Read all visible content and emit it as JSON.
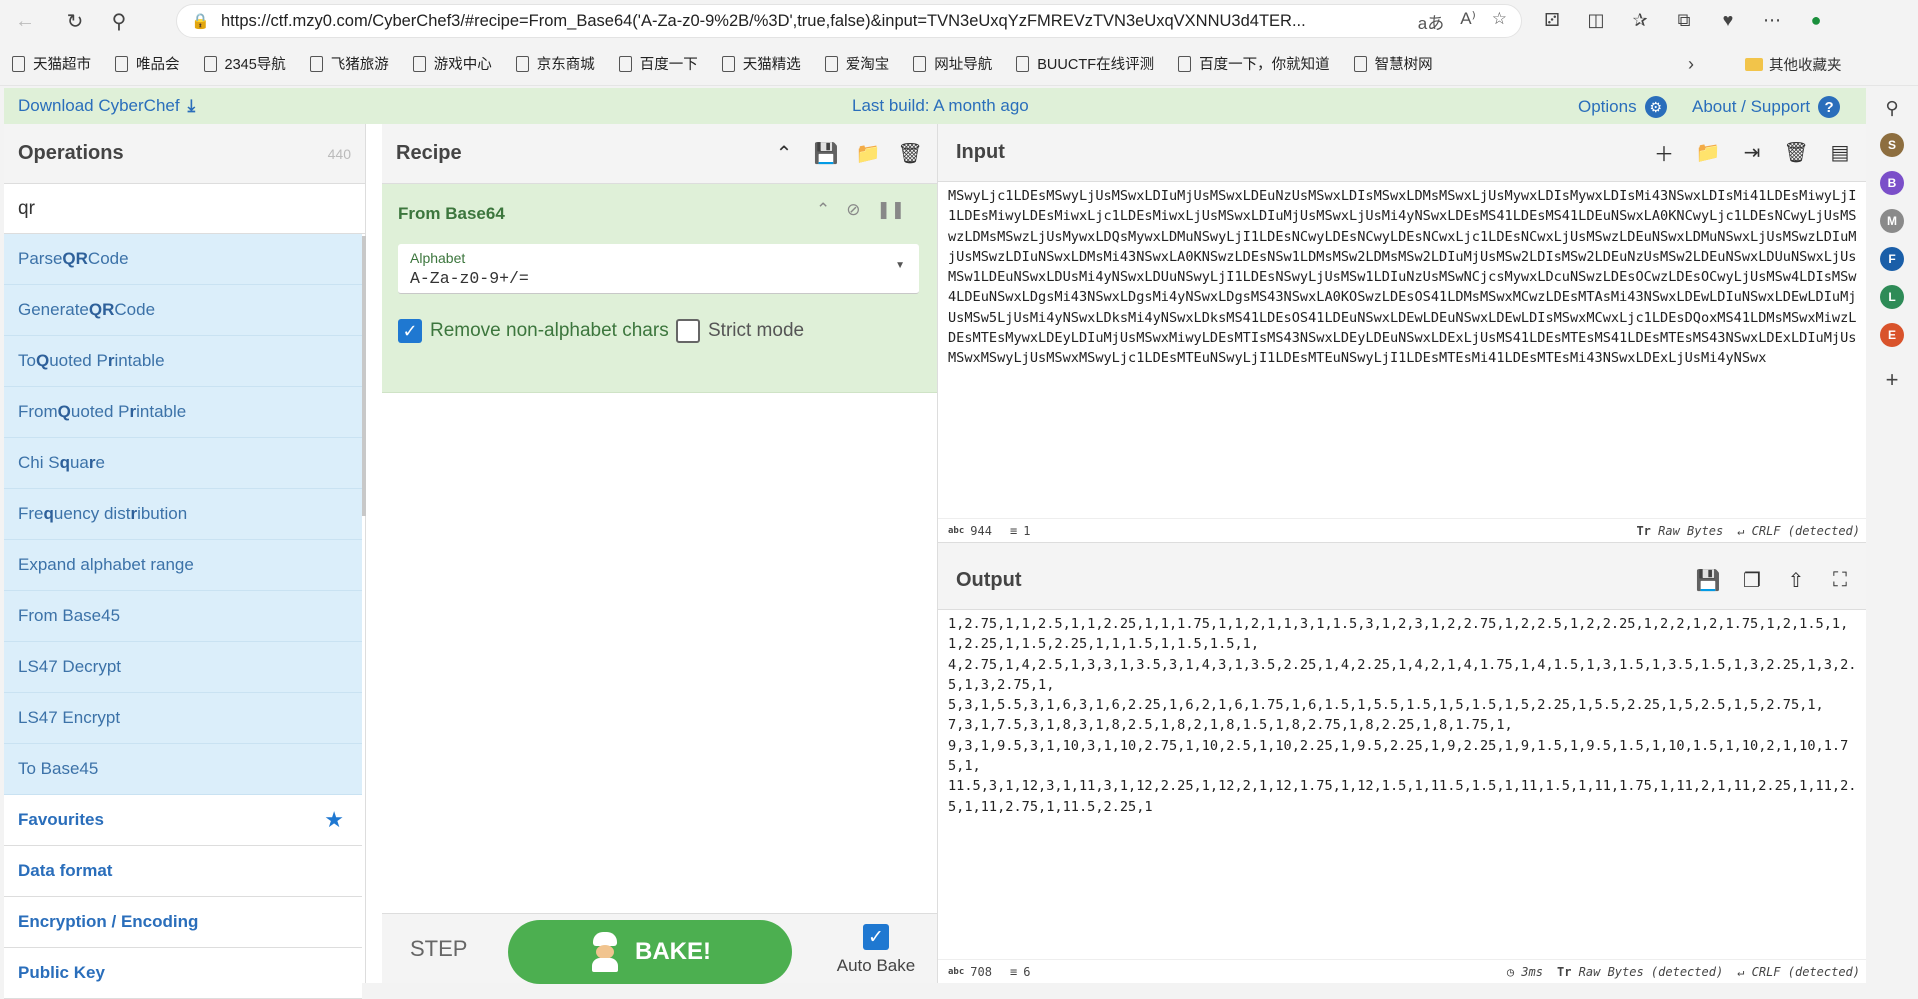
{
  "browser": {
    "url": "https://ctf.mzy0.com/CyberChef3/#recipe=From_Base64('A-Za-z0-9%2B/%3D',true,false)&input=TVN3eUxqYzFMREVzTVN3eUxqVXNNU3d4TER...",
    "bookmarks": [
      "天猫超市",
      "唯品会",
      "2345导航",
      "飞猪旅游",
      "游戏中心",
      "京东商城",
      "百度一下",
      "天猫精选",
      "爱淘宝",
      "网址导航",
      "BUUCTF在线评测",
      "百度一下，你就知道",
      "智慧树网"
    ],
    "other_bookmarks": "其他收藏夹",
    "profile_letters": [
      "S",
      "B",
      "M",
      "F",
      "L",
      "E"
    ],
    "profile_colors": [
      "#8d6e3f",
      "#7b4fc9",
      "#8a8a8a",
      "#1a5ea8",
      "#2e8b57",
      "#d9532b"
    ]
  },
  "banner": {
    "download": "Download CyberChef",
    "build": "Last build: A month ago",
    "options": "Options",
    "about": "About / Support"
  },
  "operations": {
    "title": "Operations",
    "count": "440",
    "search_value": "qr",
    "items": [
      {
        "pre": "Parse ",
        "hl": "QR",
        "post": " Code"
      },
      {
        "pre": "Generate ",
        "hl": "QR",
        "post": " Code"
      },
      {
        "pre": "To ",
        "hl": "Q",
        "mid": "uoted P",
        "hl2": "r",
        "post": "intable"
      },
      {
        "pre": "From ",
        "hl": "Q",
        "mid": "uoted P",
        "hl2": "r",
        "post": "intable"
      },
      {
        "pre": "Chi S",
        "hl": "q",
        "mid": "ua",
        "hl2": "r",
        "post": "e"
      },
      {
        "pre": "Fre",
        "hl": "q",
        "mid": "uency dist",
        "hl2": "r",
        "post": "ibution"
      },
      {
        "pre": "Expand alphabet range",
        "hl": "",
        "post": ""
      },
      {
        "pre": "From Base45",
        "hl": "",
        "post": ""
      },
      {
        "pre": "LS47 Decrypt",
        "hl": "",
        "post": ""
      },
      {
        "pre": "LS47 Encrypt",
        "hl": "",
        "post": ""
      },
      {
        "pre": "To Base45",
        "hl": "",
        "post": ""
      }
    ],
    "categories": [
      "Favourites",
      "Data format",
      "Encryption / Encoding",
      "Public Key"
    ]
  },
  "recipe": {
    "title": "Recipe",
    "op_name": "From Base64",
    "alphabet_label": "Alphabet",
    "alphabet_value": "A-Za-z0-9+/=",
    "remove_label": "Remove non-alphabet chars",
    "strict_label": "Strict mode",
    "step": "STEP",
    "bake": "BAKE!",
    "auto_bake": "Auto Bake"
  },
  "input": {
    "title": "Input",
    "text": "MSwyLjc1LDEsMSwyLjUsMSwxLDIuMjUsMSwxLDEuNzUsMSwxLDIsMSwxLDMsMSwxLjUsMywxLDIsMywxLDIsMi43NSwxLDIsMi41LDEsMiwyLjI1LDEsMiwyLDEsMiwxLjc1LDEsMiwxLjUsMSwxLDIuMjUsMSwxLjUsMi4yNSwxLDEsMS41LDEsMS41LDEuNSwxLA0KNCwyLjc1LDEsNCwyLjUsMSwzLDMsMSwzLjUsMywxLDQsMywxLDMuNSwyLjI1LDEsNCwyLDEsNCwyLDEsNCwxLjc1LDEsNCwxLjUsMSwzLDEuNSwxLDMuNSwxLjUsMSwzLDIuMjUsMSwzLDIuNSwxLDMsMi43NSwxLA0KNSwzLDEsNSw1LDMsMSw2LDMsMSw2LDIuMjUsMSw2LDIsMSw2LDEuNzUsMSw2LDEuNSwxLDUuNSwxLjUsMSw1LDEuNSwxLDUsMi4yNSwxLDUuNSwyLjI1LDEsNSwyLjUsMSw1LDIuNzUsMSwNCjcsMywxLDcuNSwzLDEsOCwzLDEsOCwyLjUsMSw4LDIsMSw4LDEuNSwxLDgsMi43NSwxLDgsMi4yNSwxLDgsMS43NSwxLA0KOSwzLDEsOS41LDMsMSwxMCwzLDEsMTAsMi43NSwxLDEwLDIuNSwxLDEwLDIuMjUsMSw5LjUsMi4yNSwxLDksMi4yNSwxLDksMS41LDEsOS41LDEuNSwxLDEwLDEuNSwxLDEwLDIsMSwxMCwxLjc1LDEsDQoxMS41LDMsMSwxMiwzLDEsMTEsMywxLDEyLDIuMjUsMSwxMiwyLDEsMTIsMS43NSwxLDEyLDEuNSwxLDExLjUsMS41LDEsMTEsMS41LDEsMTEsMS43NSwxLDExLDIuMjUsMSwxMSwyLjUsMSwxMSwyLjc1LDEsMTEuNSwyLjI1LDEsMTEuNSwyLjI1LDEsMTEsMi41LDEsMTEsMi43NSwxLDExLjUsMi4yNSwx",
    "chars": "944",
    "lines": "1",
    "encoding": "Raw Bytes",
    "eol": "CRLF (detected)"
  },
  "output": {
    "title": "Output",
    "text": "1,2.75,1,1,2.5,1,1,2.25,1,1,1.75,1,1,2,1,1,3,1,1.5,3,1,2,3,1,2,2.75,1,2,2.5,1,2,2.25,1,2,2,1,2,1.75,1,2,1.5,1,1,2.25,1,1.5,2.25,1,1,1.5,1,1.5,1.5,1,\n4,2.75,1,4,2.5,1,3,3,1,3.5,3,1,4,3,1,3.5,2.25,1,4,2.25,1,4,2,1,4,1.75,1,4,1.5,1,3,1.5,1,3.5,1.5,1,3,2.25,1,3,2.5,1,3,2.75,1,\n5,3,1,5.5,3,1,6,3,1,6,2.25,1,6,2,1,6,1.75,1,6,1.5,1,5.5,1.5,1,5,1.5,1,5,2.25,1,5.5,2.25,1,5,2.5,1,5,2.75,1,\n7,3,1,7.5,3,1,8,3,1,8,2.5,1,8,2,1,8,1.5,1,8,2.75,1,8,2.25,1,8,1.75,1,\n9,3,1,9.5,3,1,10,3,1,10,2.75,1,10,2.5,1,10,2.25,1,9.5,2.25,1,9,2.25,1,9,1.5,1,9.5,1.5,1,10,1.5,1,10,2,1,10,1.75,1,\n11.5,3,1,12,3,1,11,3,1,12,2.25,1,12,2,1,12,1.75,1,12,1.5,1,11.5,1.5,1,11,1.5,1,11,1.75,1,11,2,1,11,2.25,1,11,2.5,1,11,2.75,1,11.5,2.25,1",
    "chars": "708",
    "lines": "6",
    "time": "3ms",
    "encoding": "Raw Bytes (detected)",
    "eol": "CRLF (detected)"
  }
}
